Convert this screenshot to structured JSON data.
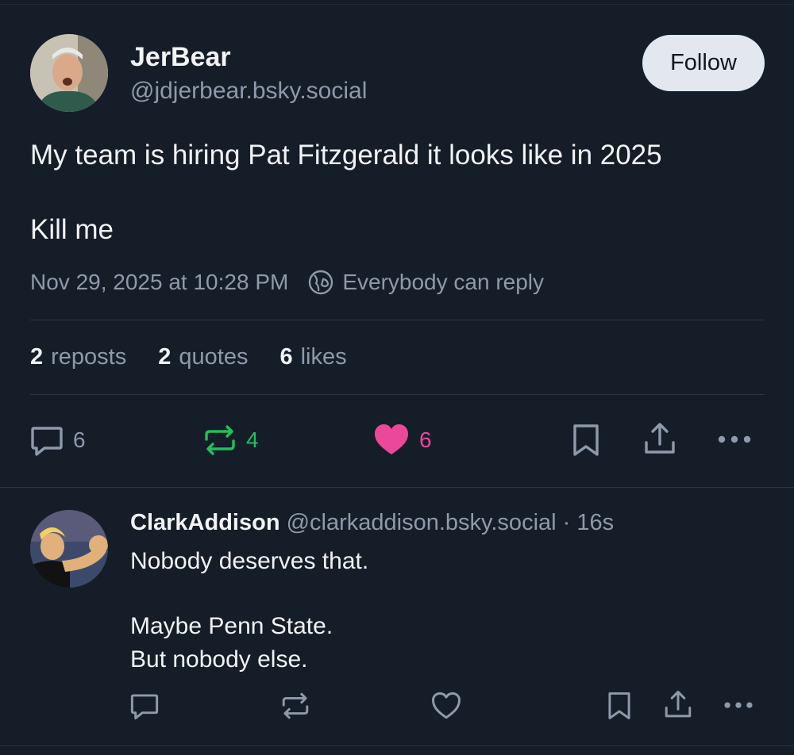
{
  "post": {
    "author": {
      "display_name": "JerBear",
      "handle": "@jdjerbear.bsky.social"
    },
    "follow_label": "Follow",
    "text_lines": [
      "My team is hiring Pat Fitzgerald it looks like in 2025",
      "Kill me"
    ],
    "timestamp": "Nov 29, 2025 at 10:28 PM",
    "reply_setting": "Everybody can reply",
    "stats": {
      "reposts_count": "2",
      "reposts_label": "reposts",
      "quotes_count": "2",
      "quotes_label": "quotes",
      "likes_count": "6",
      "likes_label": "likes"
    },
    "actions": {
      "reply_count": "6",
      "repost_count": "4",
      "like_count": "6"
    }
  },
  "reply": {
    "author": {
      "display_name": "ClarkAddison",
      "handle": "@clarkaddison.bsky.social"
    },
    "separator": "·",
    "time_ago": "16s",
    "text_lines": [
      "Nobody deserves that.",
      "Maybe Penn State.",
      "But nobody else."
    ]
  },
  "icons": {
    "reply": "reply-bubble-icon",
    "repost": "repost-icon",
    "like": "heart-icon",
    "bookmark": "bookmark-icon",
    "share": "share-icon",
    "more": "more-dots-icon",
    "reply_setting": "globe-icon"
  },
  "colors": {
    "background": "#151d28",
    "muted_text": "#8d9aab",
    "repost_active": "#20c05c",
    "like_active": "#ec4899",
    "follow_button": "#e3e8ee"
  }
}
